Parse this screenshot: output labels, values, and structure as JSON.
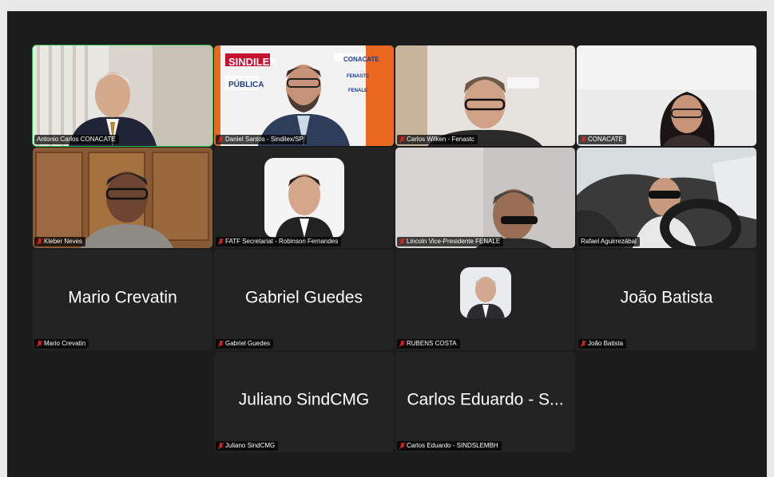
{
  "participants": [
    {
      "label": "Antonio Carlos CONACATE",
      "muted": false,
      "active": true
    },
    {
      "label": "Daniel Santos - Sindilex/SP",
      "muted": true
    },
    {
      "label": "Carlos Wilken - Fenastc",
      "muted": true
    },
    {
      "label": "CONACATE",
      "muted": true
    },
    {
      "label": "Kleber Neves",
      "muted": true
    },
    {
      "label": "FATF Secretariat - Robinson Fernandes",
      "muted": true
    },
    {
      "label": "Lincoln  Vice-Presidente FENALE",
      "muted": true
    },
    {
      "label": "Rafael Aguirrezábal",
      "muted": false
    },
    {
      "label": "Mario Crevatin",
      "display": "Mario Crevatin",
      "muted": true
    },
    {
      "label": "Gabriel Guedes",
      "display": "Gabriel Guedes",
      "muted": true
    },
    {
      "label": "RUBENS COSTA",
      "muted": true
    },
    {
      "label": "João Batista",
      "display": "João Batista",
      "muted": true
    },
    {
      "label": "Juliano SindCMG",
      "display": "Juliano SindCMG",
      "muted": true
    },
    {
      "label": "Carlos Eduardo - SINDSLEMBH",
      "display": "Carlos Eduardo - S...",
      "muted": true
    }
  ],
  "banner": {
    "sindilex": "SINDILEX",
    "conacate": "CONACATE",
    "fenastc": "FENASTC",
    "publica": "PÚBLICA",
    "fenale": "FENALE"
  },
  "colors": {
    "mute_icon": "#e02424",
    "active_border": "#2bbf4a",
    "tile_bg": "#232323"
  }
}
